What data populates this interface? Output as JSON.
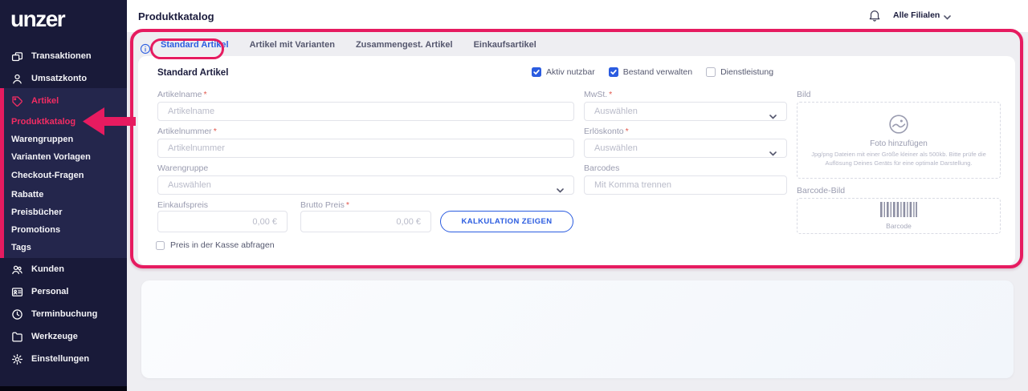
{
  "colors": {
    "brand_pink": "#e61b60",
    "sidebar_navy": "#191a39",
    "sidebar_active_bg": "#24264c",
    "accent_blue": "#2b5ce0",
    "page_bg": "#eeeef2"
  },
  "icons": {
    "logo": "unzer-wordmark",
    "sidebar": [
      "transactions-icon",
      "user-icon",
      "tag-icon",
      "customers-icon",
      "badge-icon",
      "clock-icon",
      "folder-icon",
      "gear-icon"
    ],
    "header": [
      "bell-icon",
      "chevron-down-icon"
    ],
    "content": [
      "info-icon",
      "photo-icon",
      "barcode-icon"
    ],
    "annotations": [
      "highlight-rect",
      "highlight-oval",
      "arrow-left"
    ]
  },
  "sidebar": {
    "logo": "unzer",
    "top_items": [
      {
        "label": "Transaktionen"
      },
      {
        "label": "Umsatzkonto"
      }
    ],
    "artikel_section": {
      "label": "Artikel",
      "active": true,
      "sub_items": [
        {
          "label": "Produktkatalog",
          "active": true
        },
        {
          "label": "Warengruppen"
        },
        {
          "label": "Varianten Vorlagen"
        },
        {
          "label": "Checkout-Fragen"
        },
        {
          "label": "Rabatte"
        },
        {
          "label": "Preisbücher"
        },
        {
          "label": "Promotions"
        },
        {
          "label": "Tags"
        }
      ]
    },
    "bottom_items": [
      {
        "label": "Kunden"
      },
      {
        "label": "Personal"
      },
      {
        "label": "Terminbuchung"
      },
      {
        "label": "Werkzeuge"
      },
      {
        "label": "Einstellungen"
      }
    ]
  },
  "header": {
    "title": "Produktkatalog",
    "store_selector": "Alle Filialen"
  },
  "tabs": {
    "items": [
      {
        "label": "Standard Artikel",
        "active": true
      },
      {
        "label": "Artikel mit Varianten"
      },
      {
        "label": "Zusammengest. Artikel"
      },
      {
        "label": "Einkaufsartikel"
      }
    ]
  },
  "form": {
    "title": "Standard Artikel",
    "checkboxes": [
      {
        "label": "Aktiv nutzbar",
        "checked": true
      },
      {
        "label": "Bestand verwalten",
        "checked": true
      },
      {
        "label": "Dienstleistung",
        "checked": false
      }
    ],
    "fields": {
      "artikelname": {
        "label": "Artikelname",
        "required_mark": "*",
        "placeholder": "Artikelname"
      },
      "artikelnummer": {
        "label": "Artikelnummer",
        "required_mark": "*",
        "placeholder": "Artikelnummer"
      },
      "warengruppe": {
        "label": "Warengruppe",
        "placeholder": "Auswählen"
      },
      "mwst": {
        "label": "MwSt.",
        "required_mark": "*",
        "placeholder": "Auswählen"
      },
      "erloeskonto": {
        "label": "Erlöskonto",
        "required_mark": "*",
        "placeholder": "Auswählen"
      },
      "barcodes": {
        "label": "Barcodes",
        "placeholder": "Mit Komma trennen"
      },
      "einkaufspreis": {
        "label": "Einkaufspreis",
        "placeholder": "0,00 €"
      },
      "brutto_preis": {
        "label": "Brutto Preis",
        "required_mark": "*",
        "placeholder": "0,00 €"
      }
    },
    "kalkulation_button": "KALKULATION ZEIGEN",
    "price_checkbox": {
      "label": "Preis in der Kasse abfragen",
      "checked": false
    },
    "bild": {
      "label": "Bild",
      "cta": "Foto hinzufügen",
      "hint": "Jpg/png Dateien mit einer Größe kleiner als 500kb. Bitte prüfe die Auflösung Deines Geräts für eine optimale Darstellung."
    },
    "barcode_bild": {
      "label": "Barcode-Bild",
      "caption": "Barcode"
    }
  }
}
